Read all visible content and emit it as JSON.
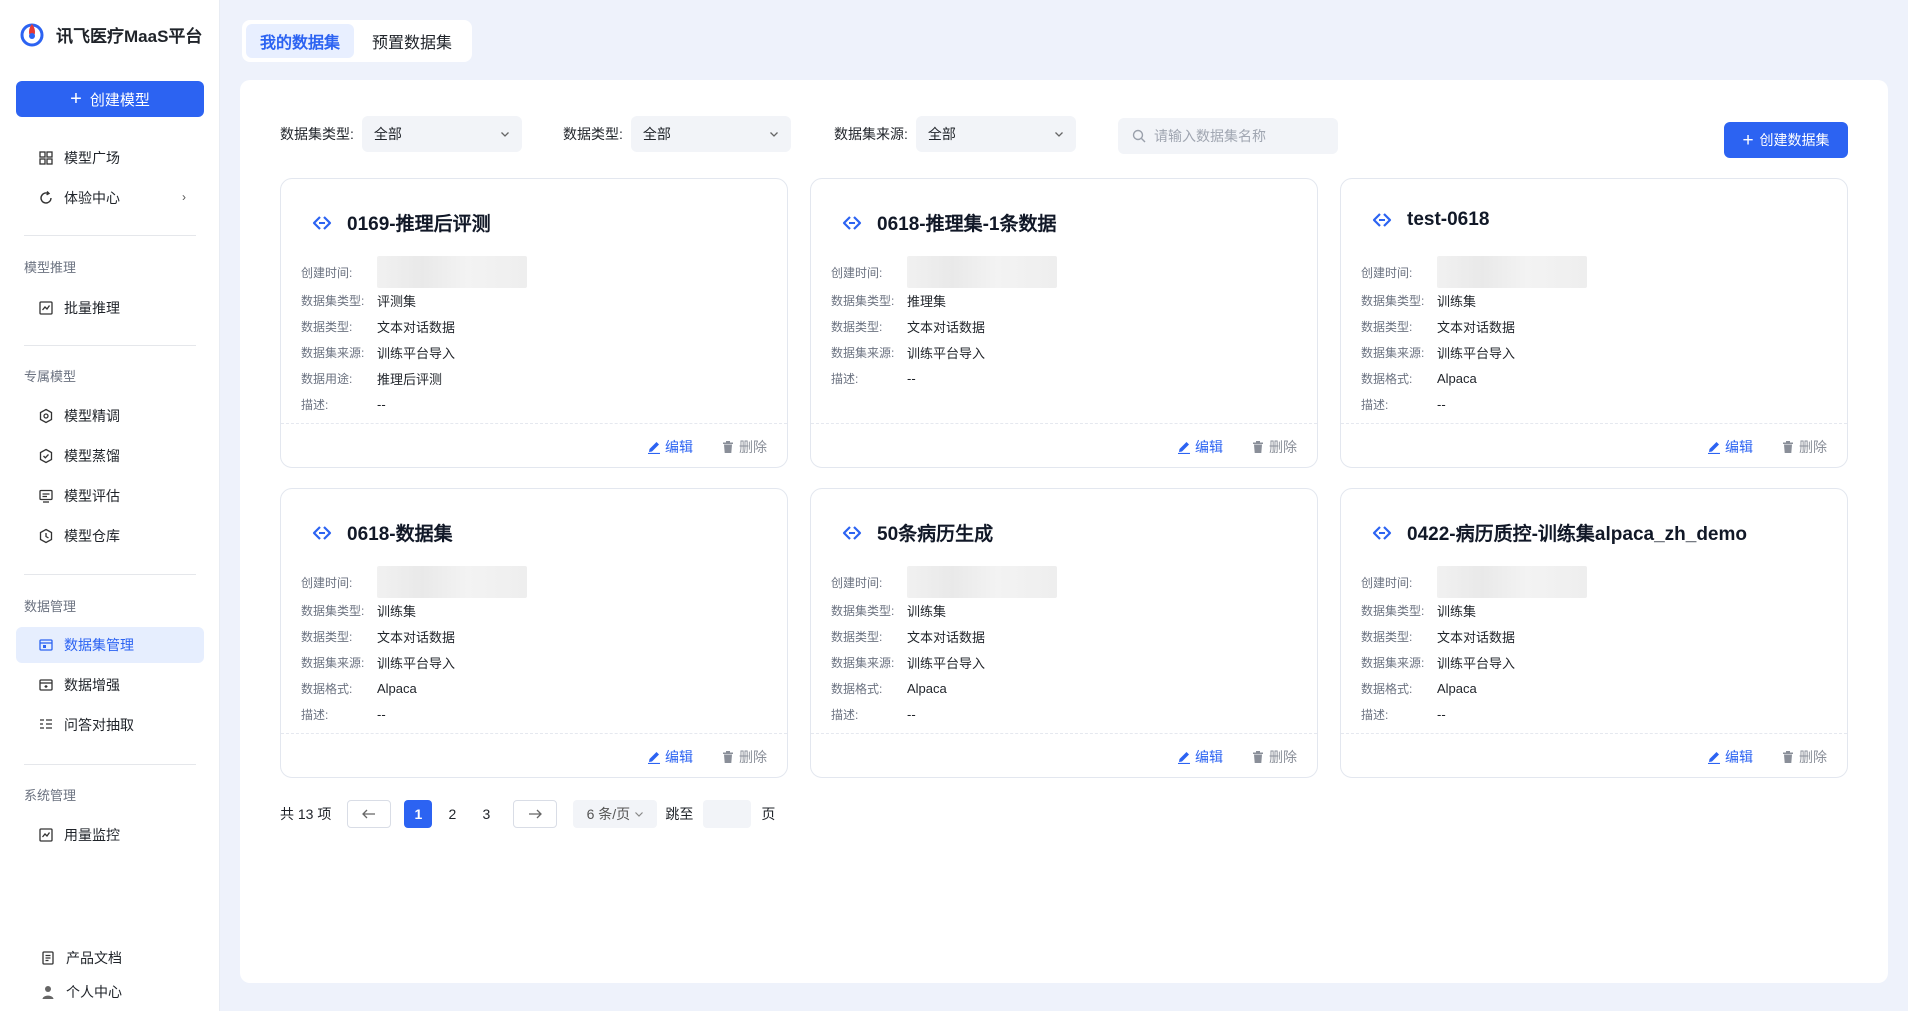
{
  "brand": {
    "name": "讯飞医疗MaaS平台"
  },
  "sidebar": {
    "create_label": "创建模型",
    "top_items": [
      {
        "label": "模型广场"
      },
      {
        "label": "体验中心"
      }
    ],
    "sections": [
      {
        "title": "模型推理",
        "items": [
          {
            "label": "批量推理"
          }
        ]
      },
      {
        "title": "专属模型",
        "items": [
          {
            "label": "模型精调"
          },
          {
            "label": "模型蒸馏"
          },
          {
            "label": "模型评估"
          },
          {
            "label": "模型仓库"
          }
        ]
      },
      {
        "title": "数据管理",
        "items": [
          {
            "label": "数据集管理"
          },
          {
            "label": "数据增强"
          },
          {
            "label": "问答对抽取"
          }
        ]
      },
      {
        "title": "系统管理",
        "items": [
          {
            "label": "用量监控"
          }
        ]
      }
    ],
    "bottom_items": [
      {
        "label": "产品文档"
      },
      {
        "label": "个人中心"
      }
    ]
  },
  "tabs": [
    {
      "label": "我的数据集"
    },
    {
      "label": "预置数据集"
    }
  ],
  "filters": {
    "dataset_type": {
      "label": "数据集类型:",
      "value": "全部"
    },
    "data_type": {
      "label": "数据类型:",
      "value": "全部"
    },
    "source": {
      "label": "数据集来源:",
      "value": "全部"
    }
  },
  "search": {
    "placeholder": "请输入数据集名称"
  },
  "create_dataset_label": "创建数据集",
  "labels": {
    "created": "创建时间:",
    "dataset_type": "数据集类型:",
    "data_type": "数据类型:",
    "source": "数据集来源:",
    "usage": "数据用途:",
    "format": "数据格式:",
    "desc": "描述:",
    "edit": "编辑",
    "delete": "删除"
  },
  "cards": [
    {
      "title": "0169-推理后评测",
      "rows": [
        {
          "k": "dataset_type",
          "v": "评测集"
        },
        {
          "k": "data_type",
          "v": "文本对话数据"
        },
        {
          "k": "source",
          "v": "训练平台导入"
        },
        {
          "k": "usage",
          "v": "推理后评测"
        },
        {
          "k": "desc",
          "v": "--"
        }
      ]
    },
    {
      "title": "0618-推理集-1条数据",
      "rows": [
        {
          "k": "dataset_type",
          "v": "推理集"
        },
        {
          "k": "data_type",
          "v": "文本对话数据"
        },
        {
          "k": "source",
          "v": "训练平台导入"
        },
        {
          "k": "desc",
          "v": "--"
        }
      ]
    },
    {
      "title": "test-0618",
      "rows": [
        {
          "k": "dataset_type",
          "v": "训练集"
        },
        {
          "k": "data_type",
          "v": "文本对话数据"
        },
        {
          "k": "source",
          "v": "训练平台导入"
        },
        {
          "k": "format",
          "v": "Alpaca"
        },
        {
          "k": "desc",
          "v": "--"
        }
      ]
    },
    {
      "title": "0618-数据集",
      "rows": [
        {
          "k": "dataset_type",
          "v": "训练集"
        },
        {
          "k": "data_type",
          "v": "文本对话数据"
        },
        {
          "k": "source",
          "v": "训练平台导入"
        },
        {
          "k": "format",
          "v": "Alpaca"
        },
        {
          "k": "desc",
          "v": "--"
        }
      ]
    },
    {
      "title": "50条病历生成",
      "rows": [
        {
          "k": "dataset_type",
          "v": "训练集"
        },
        {
          "k": "data_type",
          "v": "文本对话数据"
        },
        {
          "k": "source",
          "v": "训练平台导入"
        },
        {
          "k": "format",
          "v": "Alpaca"
        },
        {
          "k": "desc",
          "v": "--"
        }
      ]
    },
    {
      "title": "0422-病历质控-训练集alpaca_zh_demo",
      "rows": [
        {
          "k": "dataset_type",
          "v": "训练集"
        },
        {
          "k": "data_type",
          "v": "文本对话数据"
        },
        {
          "k": "source",
          "v": "训练平台导入"
        },
        {
          "k": "format",
          "v": "Alpaca"
        },
        {
          "k": "desc",
          "v": "--"
        }
      ]
    }
  ],
  "pagination": {
    "total": "共 13 项",
    "pages": [
      "1",
      "2",
      "3"
    ],
    "current": "1",
    "page_size": "6 条/页",
    "jump_label": "跳至",
    "page_suffix": "页"
  },
  "colors": {
    "primary": "#2c63f2",
    "bg": "#eef2fb"
  }
}
